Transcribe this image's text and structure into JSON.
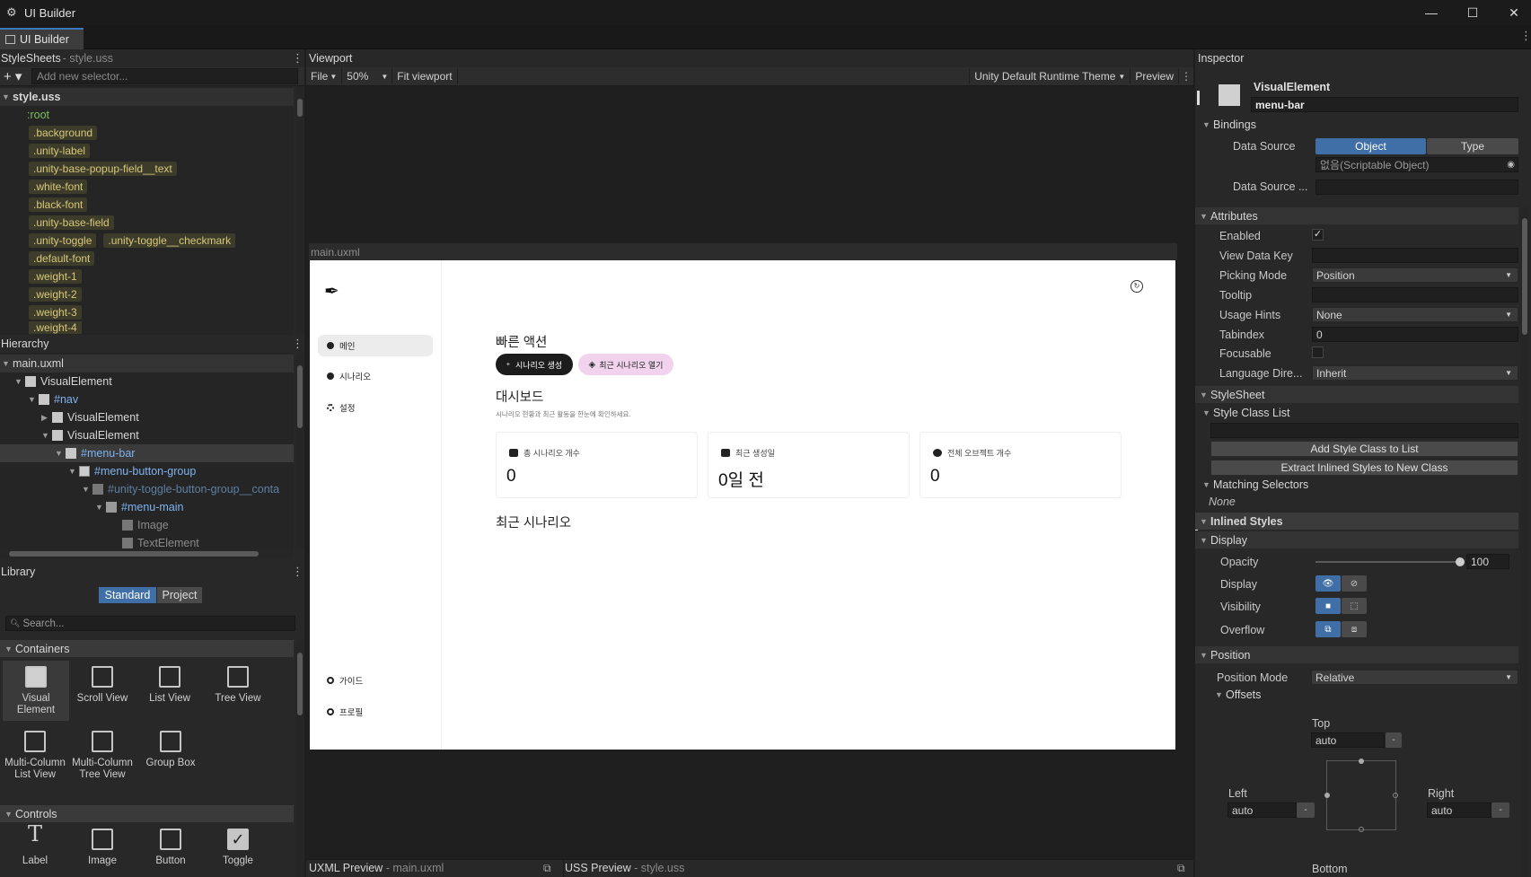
{
  "window": {
    "title": "UI Builder"
  },
  "tab": {
    "label": "UI Builder"
  },
  "stylesheets": {
    "header": "StyleSheets",
    "sub": "- style.uss",
    "add_placeholder": "Add new selector...",
    "file": "style.uss",
    "root": ":root",
    "selectors": [
      ".background",
      ".unity-label",
      ".unity-base-popup-field__text",
      ".white-font",
      ".black-font",
      ".unity-base-field",
      ".unity-toggle",
      ".unity-toggle__checkmark",
      ".default-font",
      ".weight-1",
      ".weight-2",
      ".weight-3",
      ".weight-4"
    ]
  },
  "hierarchy": {
    "header": "Hierarchy",
    "file": "main.uxml",
    "items": [
      "VisualElement",
      "#nav",
      "VisualElement",
      "VisualElement",
      "#menu-bar",
      "#menu-button-group",
      "#unity-toggle-button-group__conta",
      "#menu-main",
      "Image",
      "TextElement"
    ]
  },
  "library": {
    "header": "Library",
    "tabs": [
      "Standard",
      "Project"
    ],
    "search_placeholder": "Search...",
    "containers_label": "Containers",
    "containers": [
      "Visual Element",
      "Scroll View",
      "List View",
      "Tree View",
      "Multi-Column List View",
      "Multi-Column Tree View",
      "Group Box"
    ],
    "controls_label": "Controls",
    "controls": [
      "Label",
      "Image",
      "Button",
      "Toggle"
    ]
  },
  "viewport": {
    "header": "Viewport",
    "file_menu": "File",
    "zoom": "50%",
    "fit": "Fit viewport",
    "theme": "Unity Default Runtime Theme",
    "preview": "Preview",
    "canvas_file": "main.uxml",
    "uxml_preview": "UXML Preview",
    "uxml_sub": "- main.uxml",
    "uss_preview": "USS Preview",
    "uss_sub": "- style.uss"
  },
  "app": {
    "nav": [
      "메인",
      "시나리오",
      "설정",
      "가이드",
      "프로필"
    ],
    "quick_title": "빠른 액션",
    "btn_create": "시나리오 생성",
    "btn_open": "최근 시나리오 열기",
    "dash_title": "대시보드",
    "dash_sub": "시나리오 현황과 최근 활동을 한눈에 확인하세요.",
    "cards": [
      {
        "label": "총 시나리오 개수",
        "value": "0"
      },
      {
        "label": "최근 생성일",
        "value": "0일 전"
      },
      {
        "label": "전체 오브젝트 개수",
        "value": "0"
      }
    ],
    "recent_title": "최근 시나리오"
  },
  "inspector": {
    "header": "Inspector",
    "type": "VisualElement",
    "name": "menu-bar",
    "bindings": "Bindings",
    "data_source": "Data Source",
    "ds_object": "Object",
    "ds_type": "Type",
    "ds_value": "없음(Scriptable Object)",
    "data_source_path": "Data Source ...",
    "attributes": "Attributes",
    "enabled": "Enabled",
    "view_data_key": "View Data Key",
    "picking_mode": "Picking Mode",
    "picking_value": "Position",
    "tooltip": "Tooltip",
    "usage_hints": "Usage Hints",
    "usage_value": "None",
    "tabindex": "Tabindex",
    "tabindex_value": "0",
    "focusable": "Focusable",
    "language_dir": "Language Dire...",
    "language_value": "Inherit",
    "stylesheet": "StyleSheet",
    "style_class_list": "Style Class List",
    "add_style_class": "Add Style Class to List",
    "extract_inlined": "Extract Inlined Styles to New Class",
    "matching_selectors": "Matching Selectors",
    "matching_value": "None",
    "inlined_styles": "Inlined Styles",
    "display_section": "Display",
    "opacity": "Opacity",
    "opacity_value": "100",
    "display": "Display",
    "visibility": "Visibility",
    "overflow": "Overflow",
    "position_section": "Position",
    "position_mode": "Position Mode",
    "position_value": "Relative",
    "offsets": "Offsets",
    "top": "Top",
    "left": "Left",
    "right": "Right",
    "bottom": "Bottom",
    "auto": "auto"
  },
  "colors": {
    "accent": "#3a79bb",
    "selector_text": "#d8c87a",
    "hierarchy_blue": "#7fb2ef"
  }
}
